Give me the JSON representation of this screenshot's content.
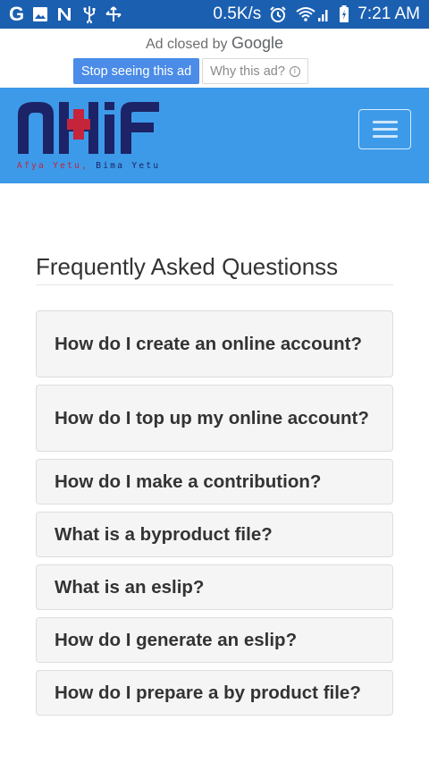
{
  "status_bar": {
    "speed": "0.5K/s",
    "time": "7:21 AM",
    "left_icons": [
      "google-icon",
      "image-icon",
      "n-icon",
      "usb-icon",
      "cross-arrows-icon"
    ],
    "right_icons": [
      "alarm-icon",
      "wifi-icon",
      "signal-icon",
      "battery-icon"
    ]
  },
  "ad": {
    "closed_text": "Ad closed by",
    "brand": "Google",
    "stop_label": "Stop seeing this ad",
    "why_label": "Why this ad?"
  },
  "header": {
    "logo_text": "NHIF",
    "tagline_part1": "Afya Yetu,",
    "tagline_part2": "Bima Yetu",
    "colors": {
      "header_bg": "#3d9ae8",
      "logo_navy": "#1c2366",
      "logo_red": "#c5243a"
    }
  },
  "main": {
    "title": "Frequently Asked Questionss",
    "faqs": [
      "How do I create an online account?",
      "How do I top up my online account?",
      "How do I make a contribution?",
      "What is a byproduct file?",
      "What is an eslip?",
      "How do I generate an eslip?",
      "How do I prepare a by product file?"
    ]
  }
}
